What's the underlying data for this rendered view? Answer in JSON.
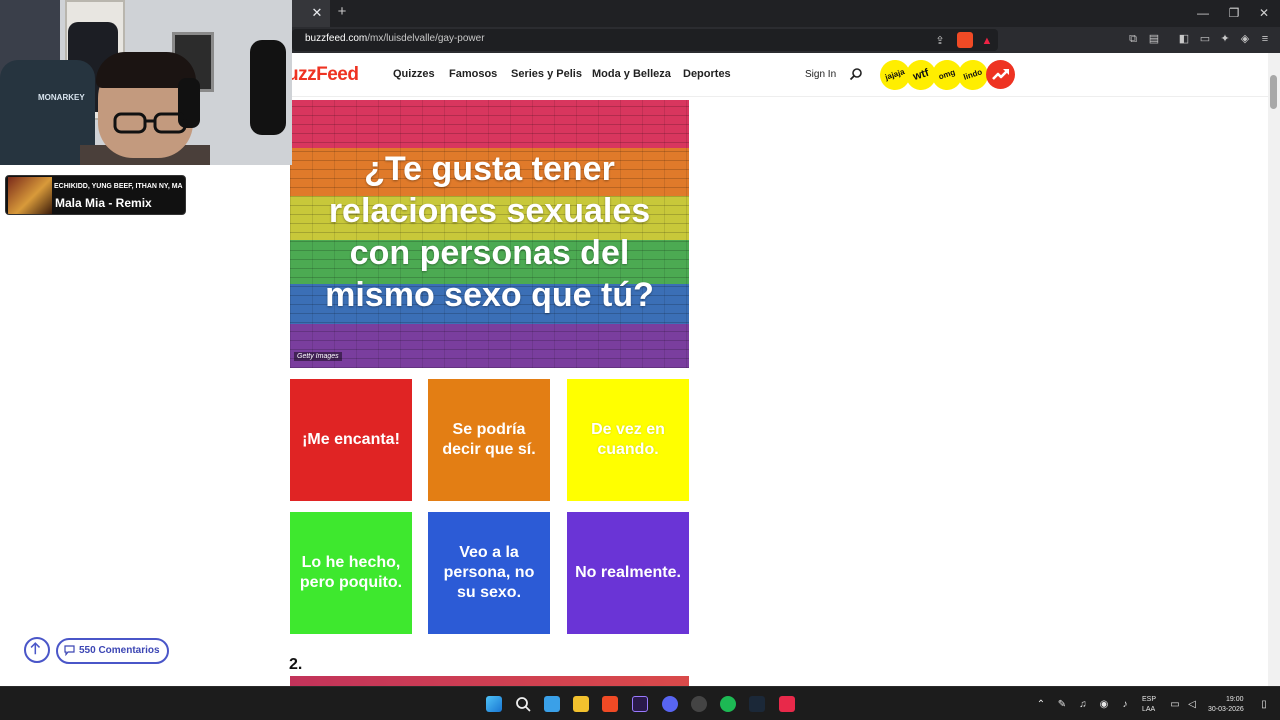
{
  "browser": {
    "url_domain": "buzzfeed.com",
    "url_path": "/mx/luisdelvalle/gay-power",
    "tab_close": "✕",
    "new_tab": "+",
    "window_controls": [
      "—",
      "❐",
      "✕"
    ]
  },
  "nav": {
    "logo": "uzzFeed",
    "links": [
      "Quizzes",
      "Famosos",
      "Series y Pelis",
      "Moda y Belleza",
      "Deportes"
    ],
    "sign_in": "Sign In",
    "badges": [
      "jajaja",
      "wtf",
      "omg",
      "lindo"
    ],
    "trending_icon": "trending-icon"
  },
  "quiz": {
    "hero_title": "¿Te gusta tener relaciones sexuales con personas del mismo sexo que tú?",
    "hero_credit": "Getty Images",
    "answers": [
      {
        "label": "¡Me encanta!",
        "color": "#e02424"
      },
      {
        "label": "Se podría decir que sí.",
        "color": "#e37e14"
      },
      {
        "label": "De vez en cuando.",
        "color": "#ffff00"
      },
      {
        "label": "Lo he hecho, pero poquito.",
        "color": "#3ee82e"
      },
      {
        "label": "Veo a la persona, no su sexo.",
        "color": "#2c5bd6"
      },
      {
        "label": "No realmente.",
        "color": "#6a34d6"
      }
    ],
    "next_question_number": "2."
  },
  "overlay": {
    "music_artist": "ECHIKIDD, YUNG BEEF, ITHAN NY, MA",
    "music_title": "Mala Mia - Remix",
    "chair_logo": "MONARKEY",
    "comments_label": "550 Comentarios"
  },
  "taskbar": {
    "language_top": "ESP",
    "language_bottom": "LAA",
    "time": "19:00",
    "date": "30-03-2026"
  },
  "colors": {
    "buzzfeed_red": "#ee3322",
    "badge_yellow": "#ffee00",
    "accent_blue": "#4a56c8"
  }
}
